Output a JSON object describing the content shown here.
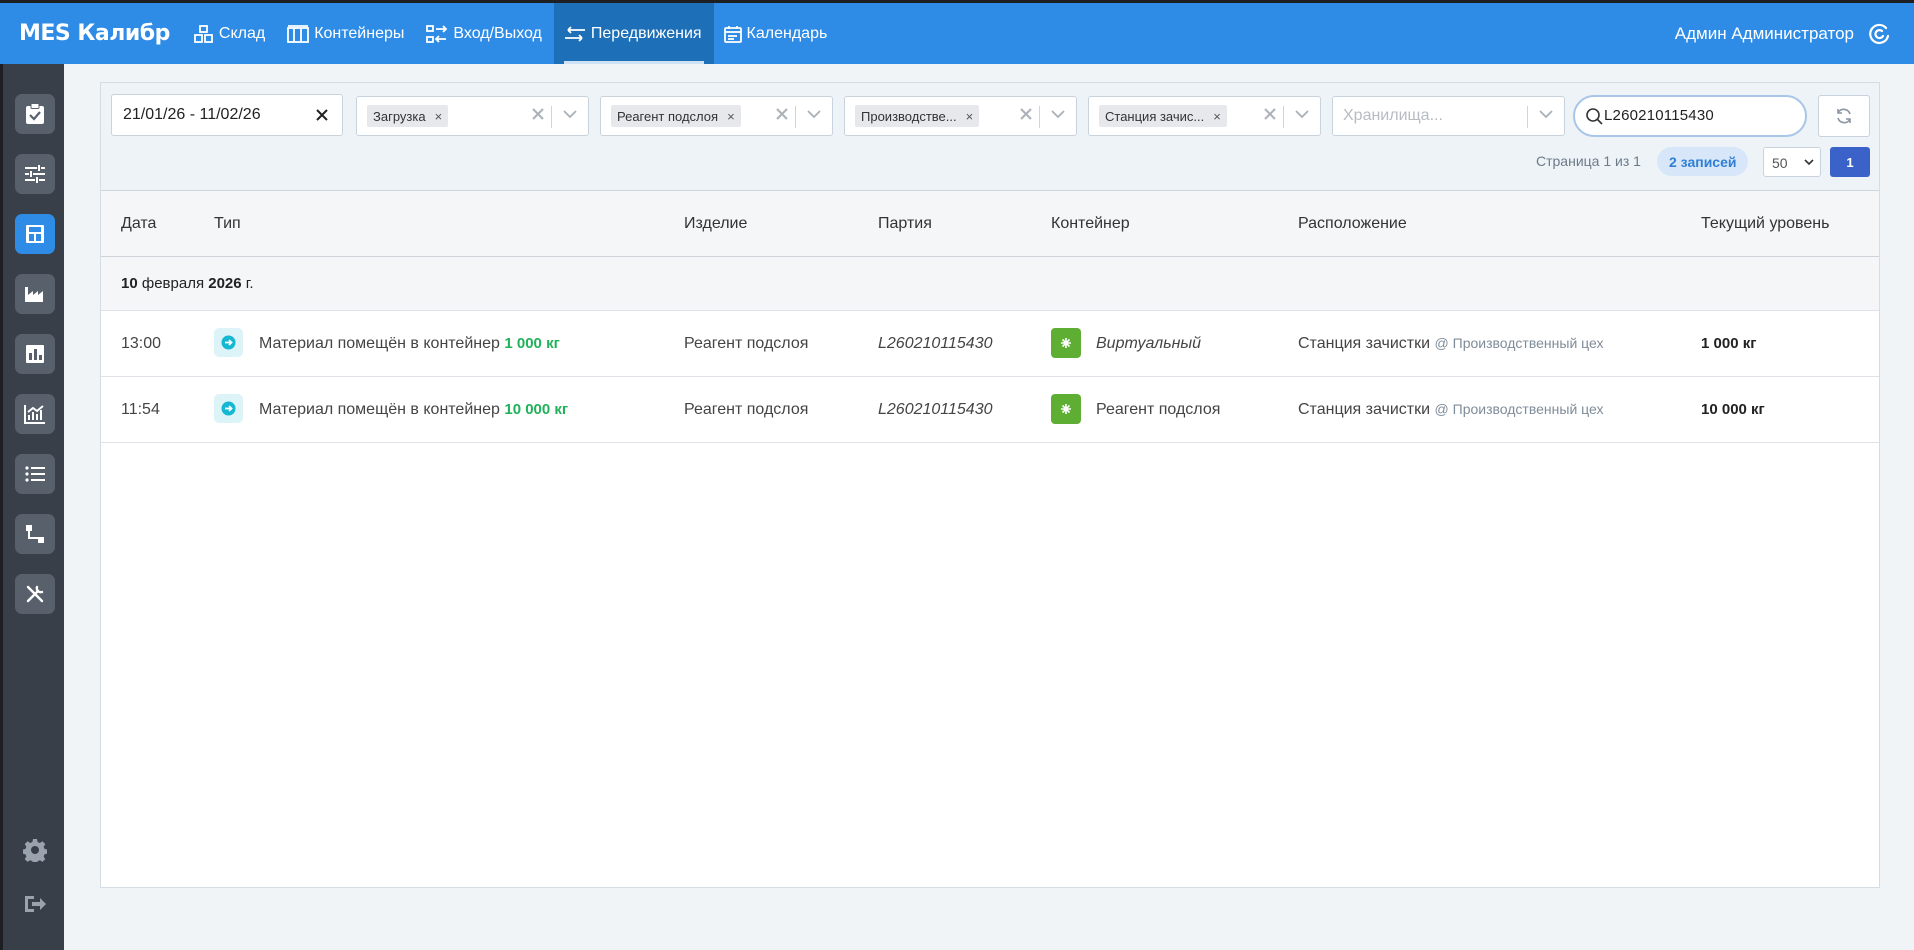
{
  "app": {
    "brand": "MES Калибр"
  },
  "nav": {
    "items": [
      {
        "label": "Склад",
        "icon": "boxes-icon"
      },
      {
        "label": "Контейнеры",
        "icon": "containers-icon"
      },
      {
        "label": "Вход/Выход",
        "icon": "in-out-icon"
      },
      {
        "label": "Передвижения",
        "icon": "transfer-arrows-icon",
        "active": true
      },
      {
        "label": "Календарь",
        "icon": "calendar-icon"
      }
    ]
  },
  "user": {
    "name": "Админ Администратор"
  },
  "sidebar": {
    "items": [
      {
        "icon": "clipboard-check-icon"
      },
      {
        "icon": "sliders-icon"
      },
      {
        "icon": "warehouse-icon",
        "active": true
      },
      {
        "icon": "factory-icon"
      },
      {
        "icon": "bar-chart-icon"
      },
      {
        "icon": "line-chart-icon"
      },
      {
        "icon": "list-icon"
      },
      {
        "icon": "route-icon"
      },
      {
        "icon": "tools-icon"
      }
    ],
    "bottom": [
      {
        "icon": "gear-icon"
      },
      {
        "icon": "logout-icon"
      }
    ]
  },
  "filters": {
    "date_range": "21/01/26 - 11/02/26",
    "type": "Загрузка",
    "product": "Реагент подслоя",
    "workshop": "Производстве...",
    "station": "Станция зачис...",
    "storage_placeholder": "Хранилища...",
    "search_value": "L260210115430"
  },
  "pagination": {
    "page_info": "Страница 1 из 1",
    "records": "2 записей",
    "per_page": "50",
    "current_page": "1"
  },
  "table": {
    "columns": {
      "date": "Дата",
      "type": "Тип",
      "product": "Изделие",
      "lot": "Партия",
      "container": "Контейнер",
      "location": "Расположение",
      "level": "Текущий уровень"
    },
    "group_pre": "10",
    "group_mid": " февраля ",
    "group_year": "2026",
    "group_post": " г.",
    "rows": [
      {
        "time": "13:00",
        "type_text": "Материал помещён в контейнер",
        "type_amount": "1 000 кг",
        "product": "Реагент подслоя",
        "lot": "L260210115430",
        "container": "Виртуальный",
        "location": "Станция зачистки",
        "location_sub": "@ Производственный цех",
        "level": "1 000 кг"
      },
      {
        "time": "11:54",
        "type_text": "Материал помещён в контейнер",
        "type_amount": "10 000 кг",
        "product": "Реагент подслоя",
        "lot": "L260210115430",
        "container": "Реагент подслоя",
        "location": "Станция зачистки",
        "location_sub": "@ Производственный цех",
        "level": "10 000 кг"
      }
    ]
  },
  "colors": {
    "topbar": "#2f8ce6",
    "topbar_active": "#1d6fb8",
    "sidebar": "#383f48",
    "accent_green": "#1fb25a",
    "container_green": "#5fae34",
    "page_button": "#3b62c9"
  }
}
